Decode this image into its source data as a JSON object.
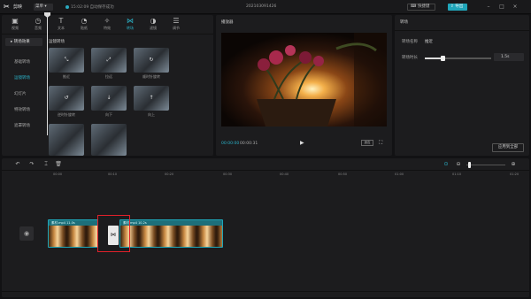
{
  "app": {
    "name": "剪映",
    "menu_label": "菜单",
    "save_status": "15:02:09 自动保存成功",
    "project_title": "202103091426",
    "shortcut_label": "快捷键",
    "export_label": "导出"
  },
  "toolbar": {
    "items": [
      {
        "label": "视频",
        "icon": "video-icon"
      },
      {
        "label": "音频",
        "icon": "audio-icon"
      },
      {
        "label": "文本",
        "icon": "text-icon"
      },
      {
        "label": "贴纸",
        "icon": "sticker-icon"
      },
      {
        "label": "特效",
        "icon": "effects-icon"
      },
      {
        "label": "转场",
        "icon": "transition-icon"
      },
      {
        "label": "滤镜",
        "icon": "filter-icon"
      },
      {
        "label": "调节",
        "icon": "adjust-icon"
      }
    ],
    "active_index": 5
  },
  "categories": {
    "header": "转场效果",
    "items": [
      "基础转场",
      "运镜转场",
      "幻灯片",
      "特效转场",
      "遮罩转场"
    ],
    "selected_index": 1
  },
  "transitions": {
    "section_title": "运镜转场",
    "items": [
      {
        "label": "推近"
      },
      {
        "label": "拉远"
      },
      {
        "label": "顺时针旋转"
      },
      {
        "label": "逆时针旋转"
      },
      {
        "label": "向下"
      },
      {
        "label": "向上"
      }
    ]
  },
  "player": {
    "title": "播放器",
    "current_time": "00:00:00",
    "total_time": "00:00:31",
    "ratio_label": "适应"
  },
  "properties": {
    "title": "转场",
    "name_label": "转场名称",
    "name_value": "推近",
    "duration_label": "转场时长",
    "duration_value": "1.5s",
    "duration_fraction": 0.27,
    "apply_all_label": "应用到全部"
  },
  "timeline": {
    "ticks": [
      "00:00",
      "00:10",
      "00:20",
      "00:30",
      "00:40",
      "00:50",
      "01:00",
      "01:10",
      "01:20"
    ],
    "clips": [
      {
        "label": "素材.mp4  11.0s"
      },
      {
        "label": "素材.mp4  10.2s"
      }
    ],
    "zoom_fraction": 0.05
  },
  "colors": {
    "accent": "#2bb3c9",
    "highlight": "#e0202a"
  }
}
